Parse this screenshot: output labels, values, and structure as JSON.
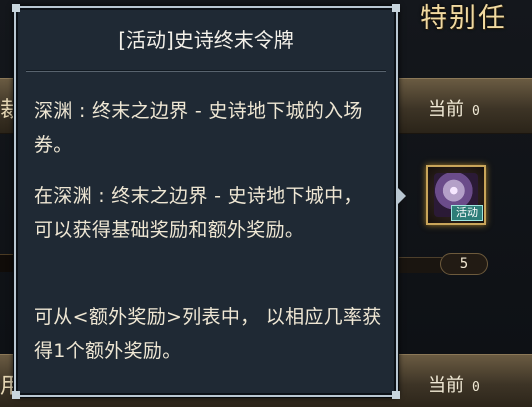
{
  "background": {
    "top_title": "特别任",
    "row_a": {
      "left_text": "裁",
      "current_label": "当前",
      "current_value": "0"
    },
    "row_b": {
      "left_text": "用",
      "current_label": "当前",
      "current_value": "0"
    },
    "item_slot": {
      "badge": "活动",
      "count": "5"
    }
  },
  "tooltip": {
    "title": "[活动]史诗终末令牌",
    "paragraphs": [
      "深渊 : 终末之边界 - 史诗地下城的入场券。",
      "在深渊 : 终末之边界 - 史诗地下城中， 可以获得基础奖励和额外奖励。",
      "可从<额外奖励>列表中， 以相应几率获得1个额外奖励。"
    ]
  },
  "colors": {
    "tooltip_bg": "#1f2934",
    "tooltip_border": "#b9c7d2",
    "text": "#efe7d4",
    "accent_gold": "#c9a55a"
  }
}
